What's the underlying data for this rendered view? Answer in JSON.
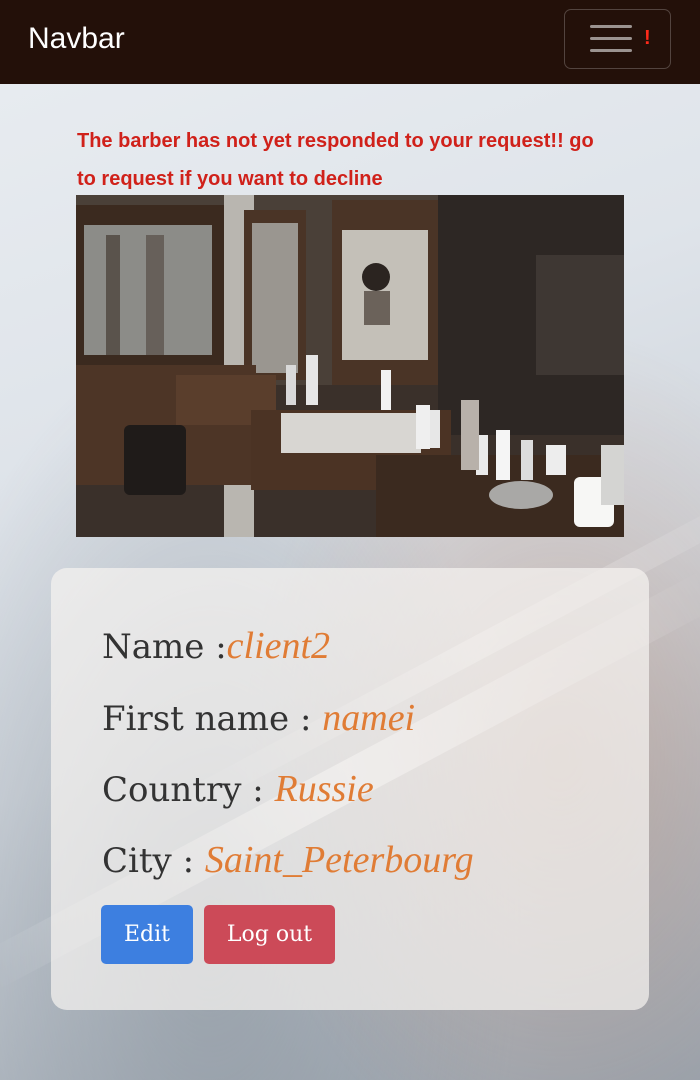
{
  "navbar": {
    "brand": "Navbar",
    "alert_indicator": "!"
  },
  "notice": "The barber has not yet responded to your request!! go to request if you want to decline",
  "image": {
    "alt": "barber shop interior"
  },
  "profile": {
    "name_label": "Name :",
    "name_value": "client2",
    "first_name_label": "First name :",
    "first_name_value": "namei",
    "country_label": "Country :",
    "country_value": "Russie",
    "city_label": "City :",
    "city_value": "Saint_Peterbourg"
  },
  "buttons": {
    "edit": "Edit",
    "logout": "Log out"
  },
  "colors": {
    "navbar_bg": "#231009",
    "notice_text": "#d0211a",
    "value_text": "#e07c35",
    "edit_button": "#3d7fe0",
    "logout_button": "#cc4a58"
  }
}
